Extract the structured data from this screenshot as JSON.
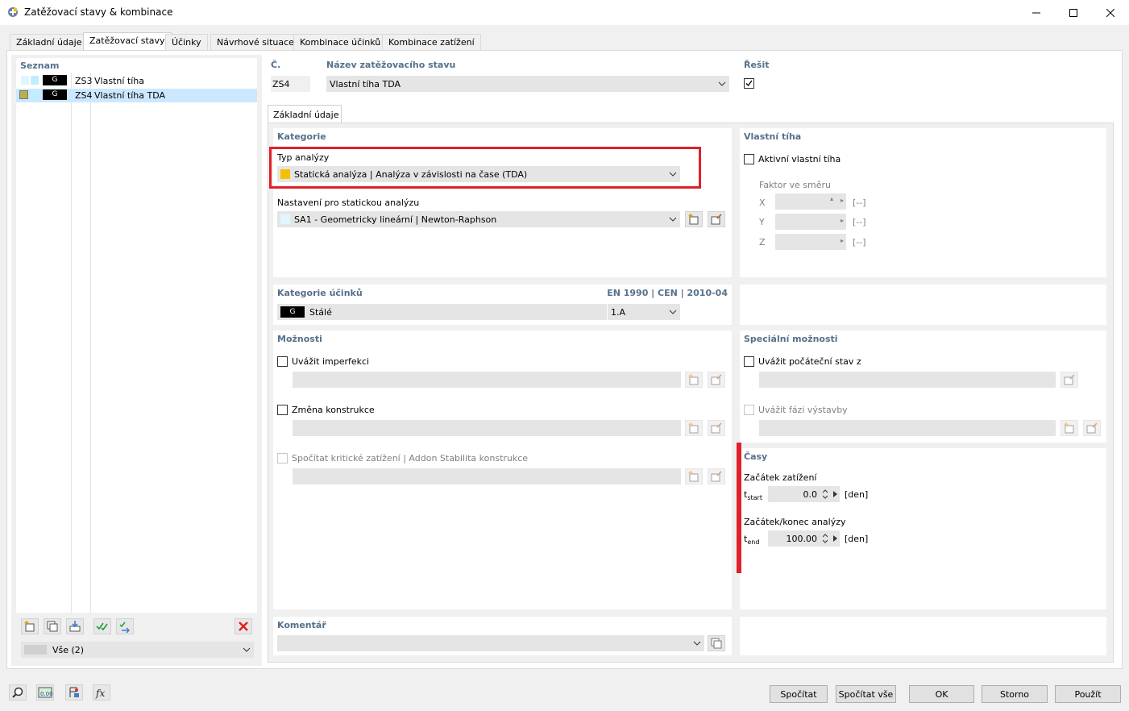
{
  "window": {
    "title": "Zatěžovací stavy & kombinace"
  },
  "tabs": [
    {
      "label": "Základní údaje"
    },
    {
      "label": "Zatěžovací stavy"
    },
    {
      "label": "Účinky"
    },
    {
      "label": "Návrhové situace"
    },
    {
      "label": "Kombinace účinků"
    },
    {
      "label": "Kombinace zatížení"
    }
  ],
  "list": {
    "header": "Seznam",
    "items": [
      {
        "badge": "G",
        "code": "ZS3",
        "name": "Vlastní tíha"
      },
      {
        "badge": "G",
        "code": "ZS4",
        "name": "Vlastní tíha TDA"
      }
    ],
    "filter": "Vše (2)"
  },
  "top": {
    "no_label": "Č.",
    "no_value": "ZS4",
    "name_label": "Název zatěžovacího stavu",
    "name_value": "Vlastní tíha TDA",
    "solve_label": "Řešit"
  },
  "subtab": "Základní údaje",
  "kategorie": {
    "header": "Kategorie",
    "analysis_label": "Typ analýzy",
    "analysis_value": "Statická analýza | Analýza v závislosti na čase (TDA)",
    "settings_label": "Nastavení pro statickou analýzu",
    "settings_value": "SA1 - Geometricky lineární | Newton-Raphson"
  },
  "vlastni": {
    "header": "Vlastní tíha",
    "active_label": "Aktivní vlastní tíha",
    "factor_label": "Faktor ve směru",
    "axes": [
      {
        "axis": "X",
        "unit": "[--]"
      },
      {
        "axis": "Y",
        "unit": "[--]"
      },
      {
        "axis": "Z",
        "unit": "[--]"
      }
    ]
  },
  "ucinky": {
    "header": "Kategorie účinků",
    "norm": "EN 1990 | CEN | 2010-04",
    "badge": "G",
    "value": "Stálé",
    "code": "1.A"
  },
  "moznosti": {
    "header": "Možnosti",
    "imperfection": "Uvážit imperfekci",
    "change": "Změna konstrukce",
    "critical": "Spočítat kritické zatížení | Addon Stabilita konstrukce"
  },
  "special": {
    "header": "Speciální možnosti",
    "initial": "Uvážit počáteční stav z",
    "phase": "Uvážit fázi výstavby"
  },
  "casy": {
    "header": "Časy",
    "start_label": "Začátek zatížení",
    "start_sym": "t",
    "start_sub": "start",
    "start_value": "0.0",
    "start_unit": "[den]",
    "end_label": "Začátek/konec analýzy",
    "end_sym": "t",
    "end_sub": "end",
    "end_value": "100.00",
    "end_unit": "[den]"
  },
  "komentar": {
    "header": "Komentář"
  },
  "buttons": {
    "calc": "Spočítat",
    "calc_all": "Spočítat vše",
    "ok": "OK",
    "cancel": "Storno",
    "apply": "Použít"
  },
  "colors": {
    "accent": "#56708a",
    "highlight": "#e0202a",
    "analysis_swatch": "#f5c000",
    "selected_row": "#cce8ff"
  }
}
